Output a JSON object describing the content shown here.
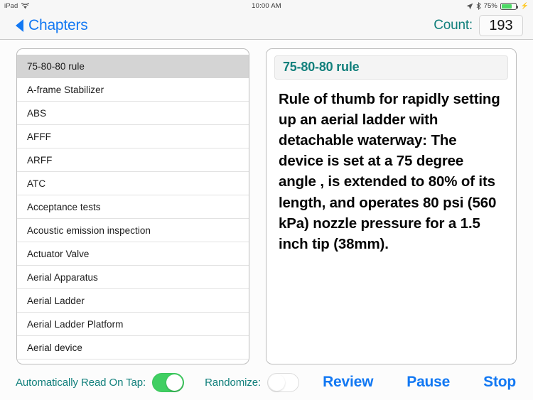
{
  "status_bar": {
    "device": "iPad",
    "wifi_icon": "wifi-icon",
    "time": "10:00 AM",
    "location_icon": "location-arrow-icon",
    "bluetooth_icon": "bluetooth-icon",
    "battery_percent": "75%",
    "battery_icon": "battery-icon",
    "charging_icon": "charging-bolt-icon"
  },
  "navbar": {
    "back_icon": "back-triangle-icon",
    "back_label": "Chapters",
    "count_label": "Count:",
    "count_value": "193"
  },
  "list": {
    "items": [
      {
        "label": "75-80-80 rule",
        "selected": true
      },
      {
        "label": "A-frame Stabilizer",
        "selected": false
      },
      {
        "label": "ABS",
        "selected": false
      },
      {
        "label": "AFFF",
        "selected": false
      },
      {
        "label": "ARFF",
        "selected": false
      },
      {
        "label": "ATC",
        "selected": false
      },
      {
        "label": "Acceptance tests",
        "selected": false
      },
      {
        "label": "Acoustic emission inspection",
        "selected": false
      },
      {
        "label": "Actuator Valve",
        "selected": false
      },
      {
        "label": "Aerial Apparatus",
        "selected": false
      },
      {
        "label": "Aerial Ladder",
        "selected": false
      },
      {
        "label": "Aerial Ladder Platform",
        "selected": false
      },
      {
        "label": "Aerial device",
        "selected": false
      }
    ]
  },
  "detail": {
    "title": "75-80-80 rule",
    "body": "Rule of thumb for rapidly setting up an aerial ladder with detachable waterway: The device is set at a 75 degree angle , is extended to 80% of its length, and operates 80 psi (560 kPa) nozzle pressure for a 1.5 inch tip (38mm)."
  },
  "toolbar": {
    "auto_read_label": "Automatically Read On Tap:",
    "auto_read_on": true,
    "randomize_label": "Randomize:",
    "randomize_on": false,
    "review_label": "Review",
    "pause_label": "Pause",
    "stop_label": "Stop"
  },
  "colors": {
    "accent_blue": "#1278f3",
    "accent_teal": "#12807c",
    "switch_green": "#40cf62",
    "selected_row": "#d4d4d4",
    "panel_border": "#bdbdbd",
    "page_background": "#fcfcfc"
  }
}
